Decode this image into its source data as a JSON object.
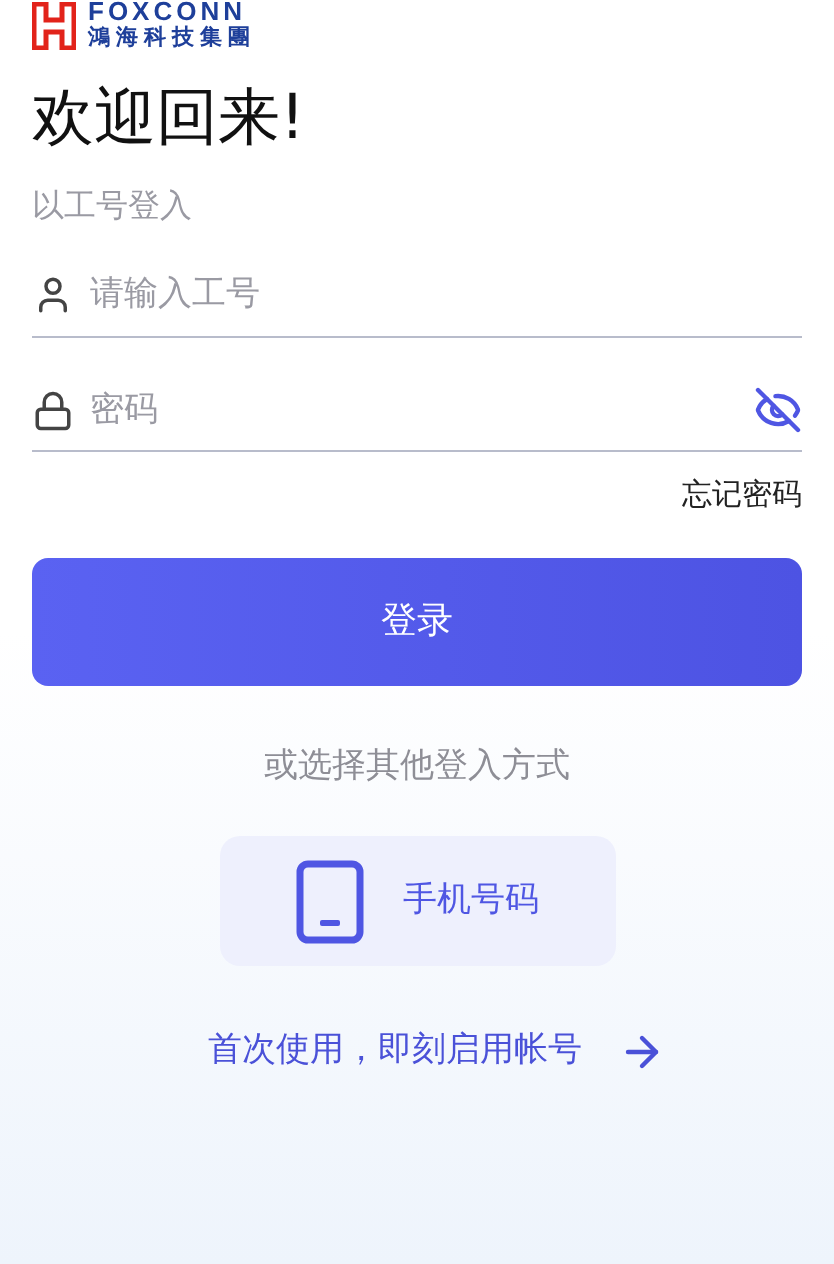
{
  "logo": {
    "wordmark": "FOXCONN",
    "company": "鴻海科技集團"
  },
  "title": "欢迎回来!",
  "subtitle": "以工号登入",
  "username_field": {
    "placeholder": "请输入工号"
  },
  "password_field": {
    "placeholder": "密码",
    "password_visible": false
  },
  "forgot_link": "忘记密码",
  "login_button": "登录",
  "alt_login_label": "或选择其他登入方式",
  "alt_methods": [
    {
      "kind": "phone",
      "label": "手机号码"
    }
  ],
  "activate_link": "首次使用，即刻启用帐号"
}
